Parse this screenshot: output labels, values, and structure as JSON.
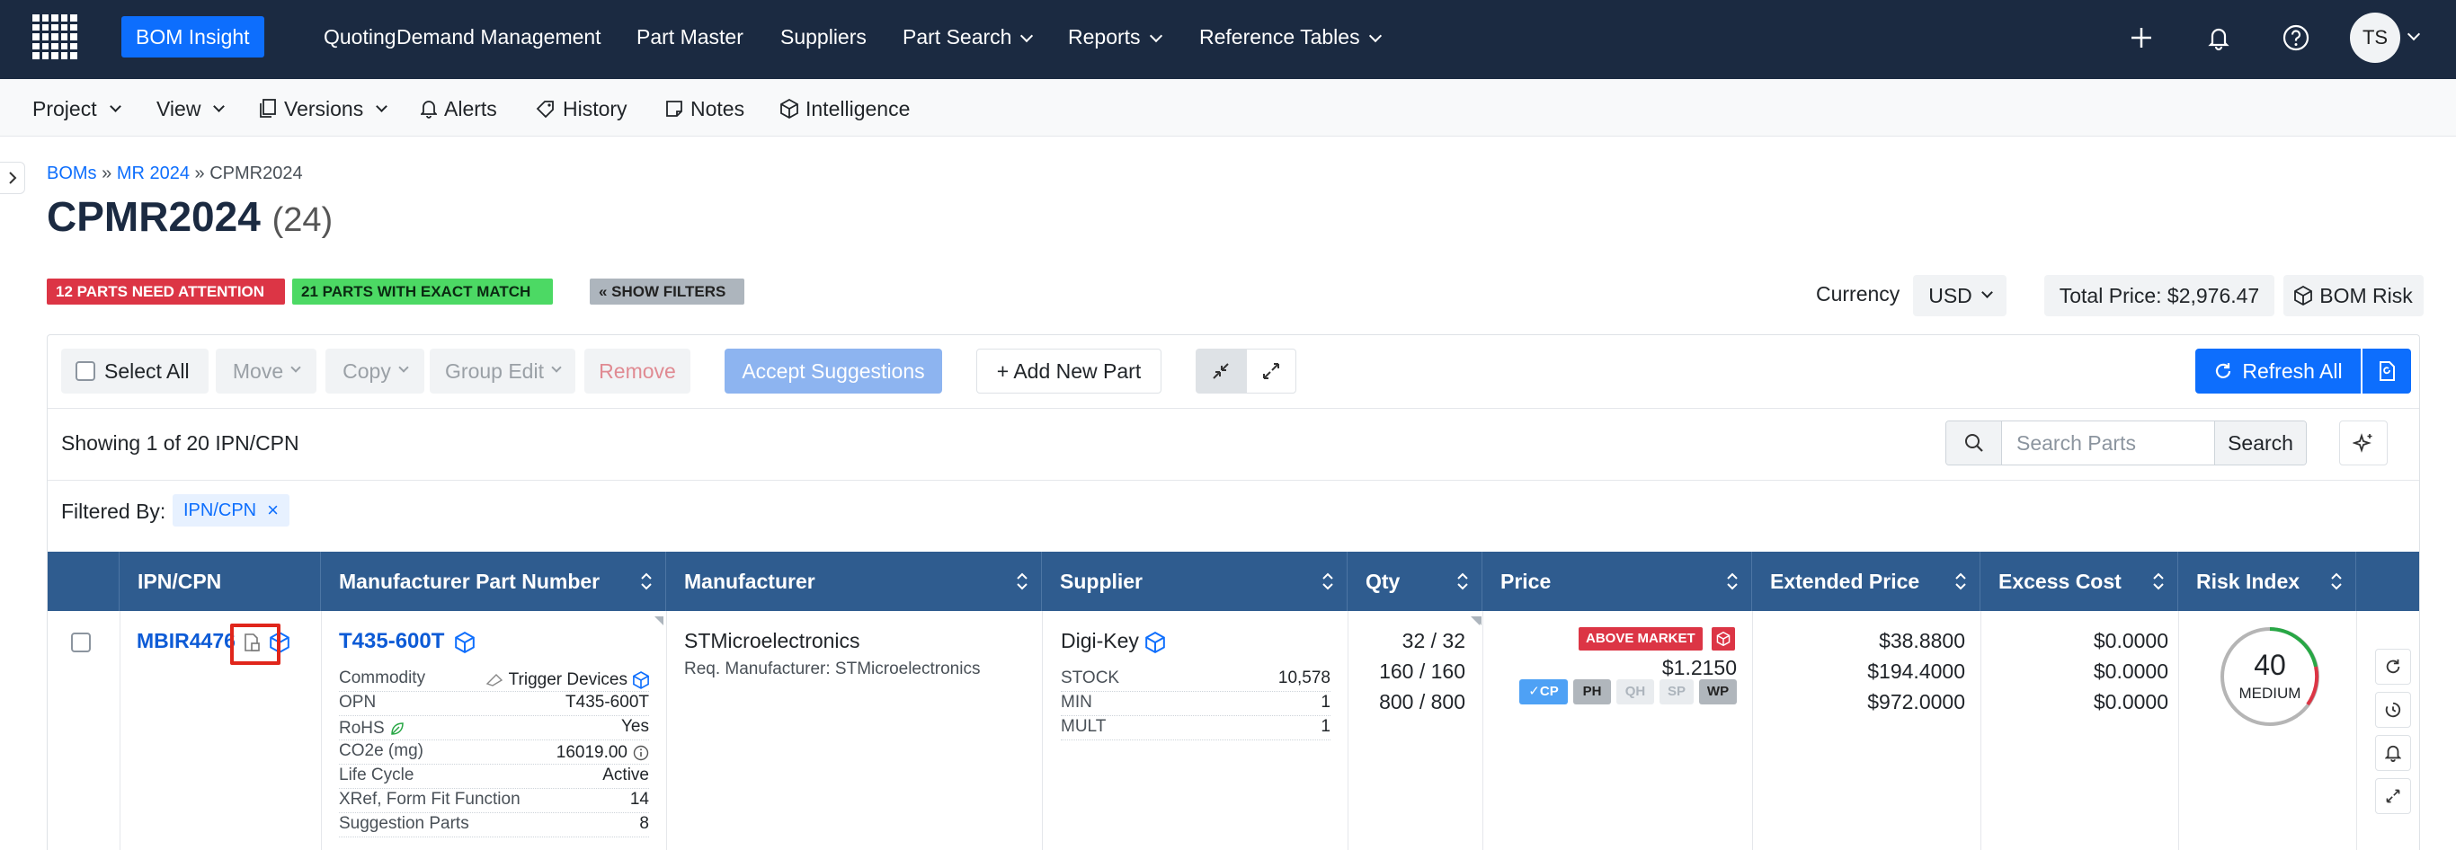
{
  "topnav": {
    "items": [
      "BOM Insight",
      "Quoting",
      "Demand Management",
      "Part Master",
      "Suppliers",
      "Part Search",
      "Reports",
      "Reference Tables"
    ],
    "active": "BOM Insight",
    "avatar_initials": "TS",
    "colors": {
      "bg": "#1b2a41",
      "active": "#0d6efd"
    }
  },
  "subnav": {
    "project": "Project",
    "view": "View",
    "versions": "Versions",
    "alerts": "Alerts",
    "history": "History",
    "notes": "Notes",
    "intelligence": "Intelligence"
  },
  "breadcrumb": {
    "root": "BOMs",
    "sep": "»",
    "parent": "MR 2024",
    "current": "CPMR2024"
  },
  "page": {
    "title": "CPMR2024",
    "count": "(24)"
  },
  "badges": {
    "attention": "12 PARTS NEED ATTENTION",
    "exact": "21 PARTS WITH EXACT MATCH",
    "filters": "« SHOW FILTERS"
  },
  "summary": {
    "currency_label": "Currency",
    "currency_value": "USD",
    "total_price": "Total Price: $2,976.47",
    "bom_risk": "BOM Risk"
  },
  "toolbar": {
    "select_all": "Select All",
    "move": "Move",
    "copy": "Copy",
    "group_edit": "Group Edit",
    "remove": "Remove",
    "accept": "Accept Suggestions",
    "add_new": "+ Add New Part",
    "refresh_all": "Refresh All"
  },
  "listing": {
    "showing": "Showing 1 of 20 IPN/CPN",
    "search_placeholder": "Search Parts",
    "search_button": "Search",
    "filtered_by": "Filtered By:",
    "filter_chip": "IPN/CPN",
    "chip_close": "×"
  },
  "table": {
    "headers": [
      "IPN/CPN",
      "Manufacturer Part Number",
      "Manufacturer",
      "Supplier",
      "Qty",
      "Price",
      "Extended Price",
      "Excess Cost",
      "Risk Index"
    ],
    "row": {
      "ipn": "MBIR4476",
      "mpn": "T435-600T",
      "manufacturer": "STMicroelectronics",
      "req_manufacturer": "Req. Manufacturer: STMicroelectronics",
      "attributes": [
        {
          "k": "Commodity",
          "v": "Trigger Devices"
        },
        {
          "k": "OPN",
          "v": "T435-600T"
        },
        {
          "k": "RoHS",
          "v": "Yes"
        },
        {
          "k": "CO2e (mg)",
          "v": "16019.00"
        },
        {
          "k": "Life Cycle",
          "v": "Active"
        },
        {
          "k": "XRef, Form Fit Function",
          "v": "14"
        },
        {
          "k": "Suggestion Parts",
          "v": "8"
        }
      ],
      "supplier": "Digi-Key",
      "supplier_stats": [
        {
          "k": "STOCK",
          "v": "10,578"
        },
        {
          "k": "MIN",
          "v": "1"
        },
        {
          "k": "MULT",
          "v": "1"
        }
      ],
      "qty": [
        "32 / 32",
        "160 / 160",
        "800 / 800"
      ],
      "price_flag": "ABOVE MARKET",
      "price": "$1.2150",
      "price_tags": [
        "CP",
        "PH",
        "QH",
        "SP",
        "WP"
      ],
      "extended": [
        "$38.8800",
        "$194.4000",
        "$972.0000"
      ],
      "excess": [
        "$0.0000",
        "$0.0000",
        "$0.0000"
      ],
      "risk_value": "40",
      "risk_label": "MEDIUM"
    }
  }
}
